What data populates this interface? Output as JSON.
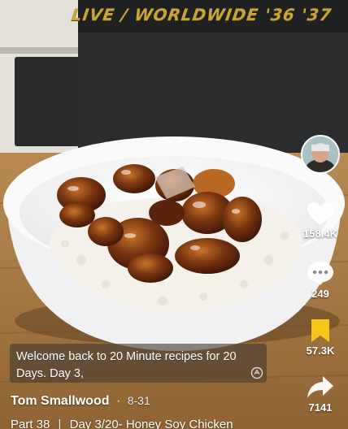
{
  "video": {
    "overlay_text": "LIVE / WORLDWIDE '36 '37"
  },
  "creator": {
    "avatar_icon": "creator-avatar",
    "name": "Tom Smallwood",
    "separator": "·",
    "date": "8-31"
  },
  "actions": {
    "like": {
      "icon": "heart-icon",
      "count": "158.4K"
    },
    "comment": {
      "icon": "comment-icon",
      "count": "249"
    },
    "save": {
      "icon": "bookmark-icon",
      "count": "57.3K",
      "color": "#f5c518"
    },
    "share": {
      "icon": "share-icon",
      "count": "7141"
    }
  },
  "caption": {
    "text": "Welcome back to 20 Minute recipes for 20 Days. Day 3,"
  },
  "description": {
    "part": "Part 38",
    "separator": "|",
    "title": "Day 3/20- Honey Soy Chicken"
  }
}
